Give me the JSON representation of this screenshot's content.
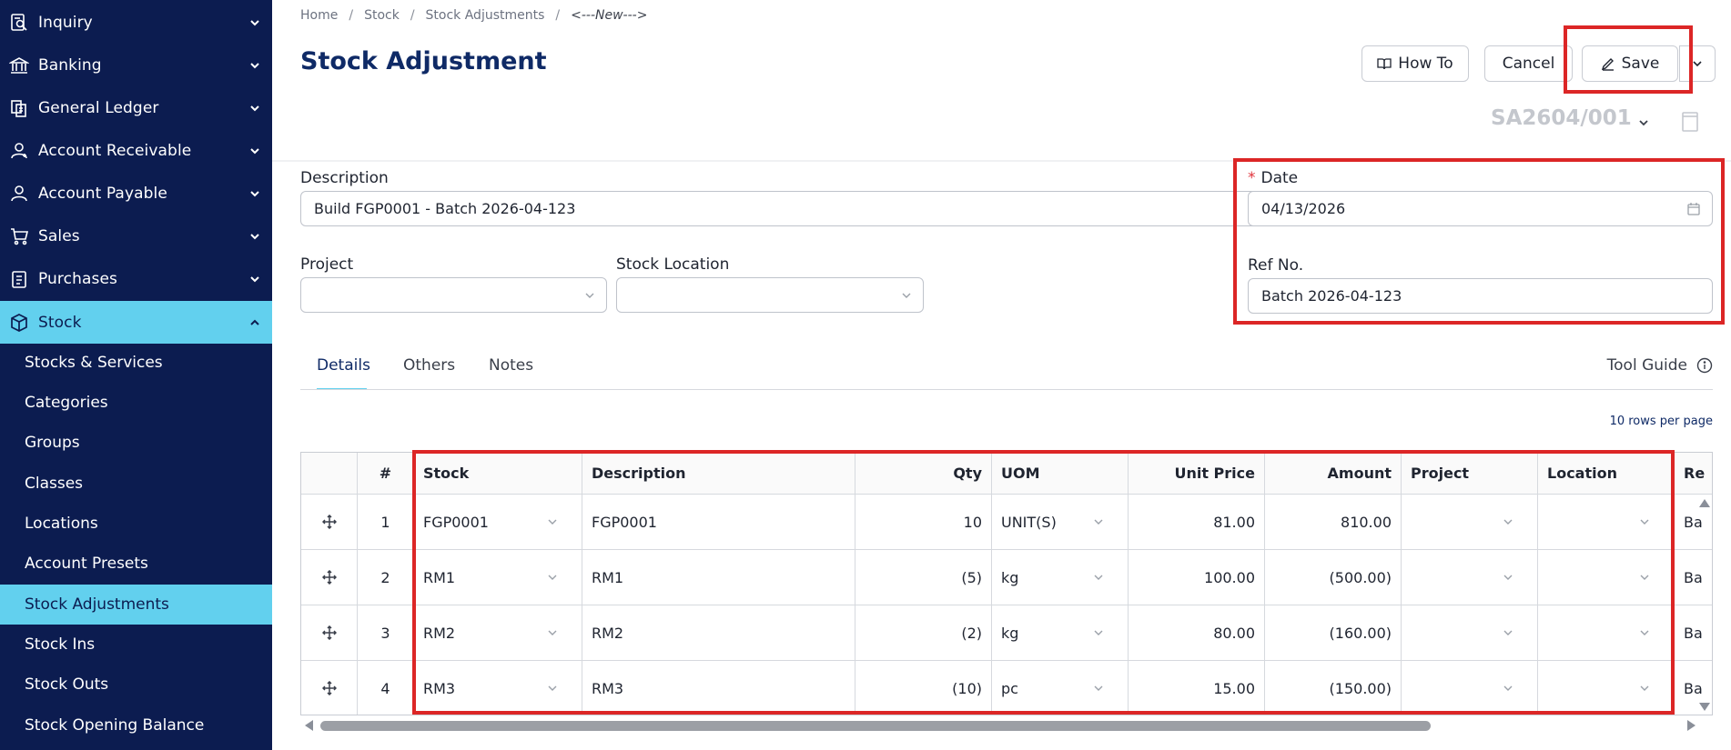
{
  "sidebar": {
    "items": [
      {
        "label": "Inquiry",
        "icon": "inquiry-icon"
      },
      {
        "label": "Banking",
        "icon": "bank-icon"
      },
      {
        "label": "General Ledger",
        "icon": "ledger-icon"
      },
      {
        "label": "Account Receivable",
        "icon": "receivable-icon"
      },
      {
        "label": "Account Payable",
        "icon": "payable-icon"
      },
      {
        "label": "Sales",
        "icon": "cart-icon"
      },
      {
        "label": "Purchases",
        "icon": "purchases-icon"
      },
      {
        "label": "Stock",
        "icon": "box-icon"
      }
    ],
    "sub_items": [
      {
        "label": "Stocks & Services"
      },
      {
        "label": "Categories"
      },
      {
        "label": "Groups"
      },
      {
        "label": "Classes"
      },
      {
        "label": "Locations"
      },
      {
        "label": "Account Presets"
      },
      {
        "label": "Stock Adjustments"
      },
      {
        "label": "Stock Ins"
      },
      {
        "label": "Stock Outs"
      },
      {
        "label": "Stock Opening Balance"
      }
    ]
  },
  "breadcrumb": {
    "items": [
      "Home",
      "Stock",
      "Stock Adjustments"
    ],
    "current": "<---New--->",
    "sep": "/"
  },
  "header": {
    "title": "Stock Adjustment",
    "how_to": "How To",
    "cancel": "Cancel",
    "save": "Save",
    "doc_no": "SA2604/001"
  },
  "form": {
    "description_label": "Description",
    "description_value": "Build FGP0001 - Batch 2026-04-123",
    "date_required": "*",
    "date_label": "Date",
    "date_value": "04/13/2026",
    "project_label": "Project",
    "project_value": "",
    "location_label": "Stock Location",
    "location_value": "",
    "ref_label": "Ref No.",
    "ref_value": "Batch 2026-04-123"
  },
  "tabs": {
    "details": "Details",
    "others": "Others",
    "notes": "Notes",
    "tool_guide": "Tool Guide",
    "rows_per_page": "10 rows per page"
  },
  "table": {
    "headers": {
      "num": "#",
      "stock": "Stock",
      "description": "Description",
      "qty": "Qty",
      "uom": "UOM",
      "unit_price": "Unit Price",
      "amount": "Amount",
      "project": "Project",
      "location": "Location",
      "ref": "Re"
    },
    "rows": [
      {
        "num": "1",
        "stock": "FGP0001",
        "description": "FGP0001",
        "qty": "10",
        "uom": "UNIT(S)",
        "unit_price": "81.00",
        "amount": "810.00",
        "project": "",
        "location": "",
        "ref": "Ba"
      },
      {
        "num": "2",
        "stock": "RM1",
        "description": "RM1",
        "qty": "(5)",
        "uom": "kg",
        "unit_price": "100.00",
        "amount": "(500.00)",
        "project": "",
        "location": "",
        "ref": "Ba"
      },
      {
        "num": "3",
        "stock": "RM2",
        "description": "RM2",
        "qty": "(2)",
        "uom": "kg",
        "unit_price": "80.00",
        "amount": "(160.00)",
        "project": "",
        "location": "",
        "ref": "Ba"
      },
      {
        "num": "4",
        "stock": "RM3",
        "description": "RM3",
        "qty": "(10)",
        "uom": "pc",
        "unit_price": "15.00",
        "amount": "(150.00)",
        "project": "",
        "location": "",
        "ref": "Ba"
      }
    ]
  },
  "colors": {
    "sidebar_bg": "#0c1c50",
    "active_bg": "#62d0ee",
    "title": "#0f2a66",
    "highlight": "#dc2626"
  }
}
